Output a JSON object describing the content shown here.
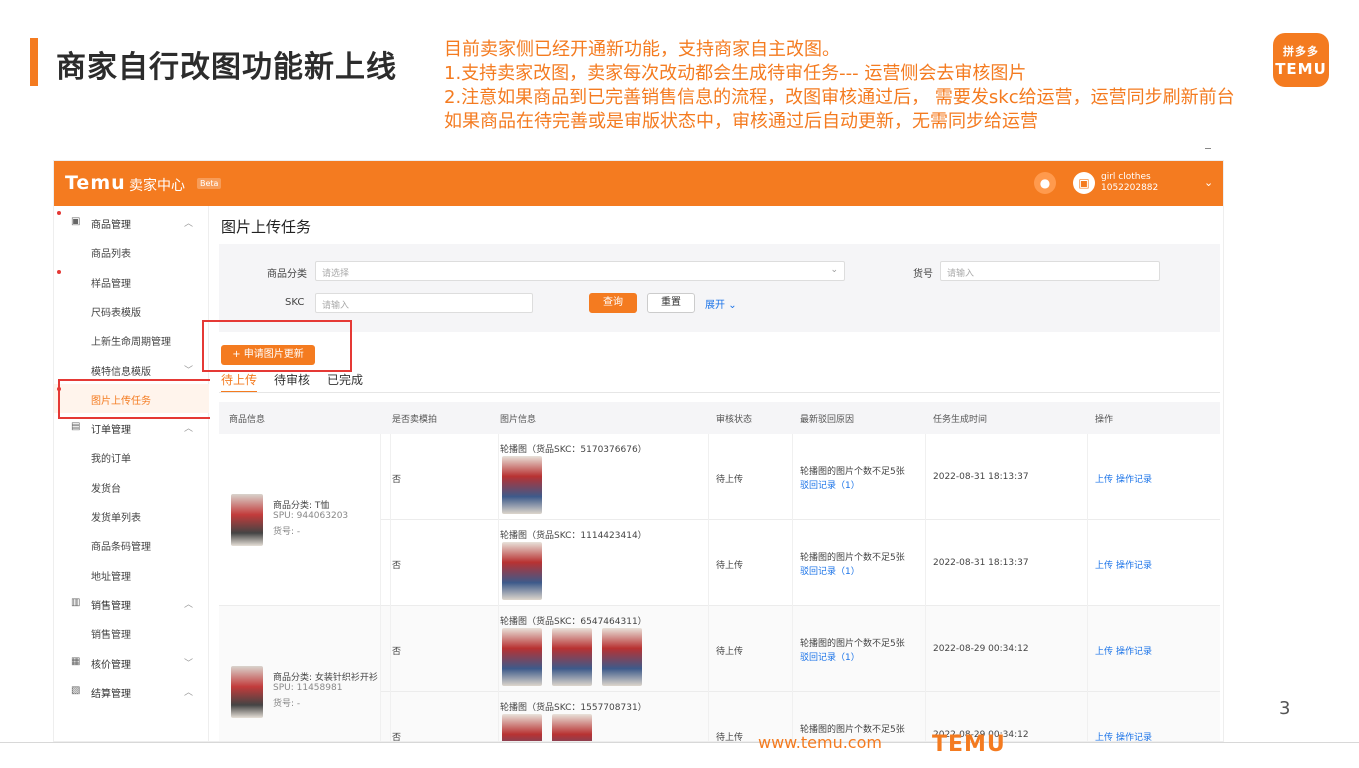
{
  "slide": {
    "title": "商家自行改图功能新上线",
    "notes": [
      "目前卖家侧已经开通新功能，支持商家自主改图。",
      "1.支持卖家改图，卖家每次改动都会生成待审任务--- 运营侧会去审核图片",
      "2.注意如果商品到已完善销售信息的流程，改图审核通过后， 需要发skc给运营，运营同步刷新前台",
      "如果商品在待完善或是审版状态中，审核通过后自动更新，无需同步给运营"
    ],
    "logo_top": "拼多多",
    "logo_bottom": "TEMU",
    "page_number": "3",
    "footer_url": "www.temu.com",
    "footer_brand": "TEMU"
  },
  "app": {
    "brand": "Temu",
    "brand_sub": "卖家中心",
    "beta": "Beta",
    "user": {
      "name": "girl clothes",
      "id": "1052202882"
    },
    "sidebar": [
      {
        "label": "商品管理",
        "type": "group",
        "dot": true,
        "arrow": "up"
      },
      {
        "label": "商品列表",
        "type": "child"
      },
      {
        "label": "样品管理",
        "type": "child",
        "dot": true
      },
      {
        "label": "尺码表模版",
        "type": "child"
      },
      {
        "label": "上新生命周期管理",
        "type": "child"
      },
      {
        "label": "模特信息模版",
        "type": "child",
        "arrow": "down"
      },
      {
        "label": "图片上传任务",
        "type": "child",
        "dot": true,
        "active": true
      },
      {
        "label": "订单管理",
        "type": "group",
        "arrow": "up"
      },
      {
        "label": "我的订单",
        "type": "child"
      },
      {
        "label": "发货台",
        "type": "child"
      },
      {
        "label": "发货单列表",
        "type": "child"
      },
      {
        "label": "商品条码管理",
        "type": "child"
      },
      {
        "label": "地址管理",
        "type": "child"
      },
      {
        "label": "销售管理",
        "type": "group",
        "arrow": "up"
      },
      {
        "label": "销售管理",
        "type": "child"
      },
      {
        "label": "核价管理",
        "type": "group",
        "arrow": "down"
      },
      {
        "label": "结算管理",
        "type": "group",
        "arrow": "up"
      }
    ],
    "page_title": "图片上传任务",
    "filters": {
      "category_label": "商品分类",
      "category_placeholder": "请选择",
      "code_label": "货号",
      "code_placeholder": "请输入",
      "skc_label": "SKC",
      "skc_placeholder": "请输入",
      "query": "查询",
      "reset": "重置",
      "expand": "展开"
    },
    "apply_button": "+ 申请图片更新",
    "tabs": [
      "待上传",
      "待审核",
      "已完成"
    ],
    "columns": [
      "商品信息",
      "是否卖模拍",
      "图片信息",
      "审核状态",
      "最新驳回原因",
      "任务生成时间",
      "操作"
    ],
    "products": [
      {
        "category": "商品分类: T恤",
        "spu": "SPU: 944063203",
        "code": "货号: -",
        "rows": [
          {
            "flag": "否",
            "image_info": "轮播图（货品SKC：5170376676）",
            "thumbs": 1,
            "status": "待上传",
            "reason": "轮播图的图片个数不足5张",
            "reason_link": "驳回记录（1）",
            "time": "2022-08-31 18:13:37",
            "actions": [
              "上传",
              "操作记录"
            ]
          },
          {
            "flag": "否",
            "image_info": "轮播图（货品SKC：1114423414）",
            "thumbs": 1,
            "status": "待上传",
            "reason": "轮播图的图片个数不足5张",
            "reason_link": "驳回记录（1）",
            "time": "2022-08-31 18:13:37",
            "actions": [
              "上传",
              "操作记录"
            ]
          }
        ]
      },
      {
        "category": "商品分类: 女装针织衫开衫",
        "spu": "SPU: 11458981",
        "code": "货号: -",
        "rows": [
          {
            "flag": "否",
            "image_info": "轮播图（货品SKC：6547464311）",
            "thumbs": 3,
            "status": "待上传",
            "reason": "轮播图的图片个数不足5张",
            "reason_link": "驳回记录（1）",
            "time": "2022-08-29 00:34:12",
            "actions": [
              "上传",
              "操作记录"
            ]
          },
          {
            "flag": "否",
            "image_info": "轮播图（货品SKC：1557708731）",
            "thumbs": 2,
            "status": "待上传",
            "reason": "轮播图的图片个数不足5张",
            "reason_link": "",
            "time": "2022-08-29 00:34:12",
            "actions": [
              "上传",
              "操作记录"
            ]
          }
        ]
      }
    ],
    "colors": {
      "accent": "#f47b20",
      "link": "#1a73e8",
      "highlight": "#e53935"
    }
  }
}
